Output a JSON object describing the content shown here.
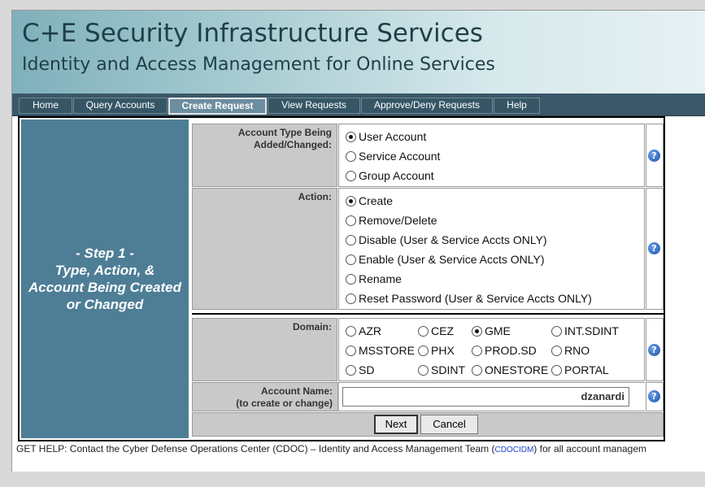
{
  "header": {
    "title": "C+E Security Infrastructure Services",
    "subtitle": "Identity and Access Management for Online Services"
  },
  "nav": {
    "tabs": [
      {
        "label": "Home"
      },
      {
        "label": "Query Accounts"
      },
      {
        "label": "Create Request",
        "active": true
      },
      {
        "label": "View Requests"
      },
      {
        "label": "Approve/Deny Requests"
      },
      {
        "label": "Help"
      }
    ]
  },
  "step": {
    "line1": "- Step 1 -",
    "line2": "Type, Action, &",
    "line3": "Account Being Created",
    "line4": "or Changed"
  },
  "account_type": {
    "label_line1": "Account Type Being",
    "label_line2": "Added/Changed:",
    "options": [
      "User Account",
      "Service Account",
      "Group Account"
    ],
    "selected": "User Account"
  },
  "action": {
    "label": "Action:",
    "options": [
      "Create",
      "Remove/Delete",
      "Disable (User & Service Accts ONLY)",
      "Enable (User & Service Accts ONLY)",
      "Rename",
      "Reset Password (User & Service Accts ONLY)"
    ],
    "selected": "Create"
  },
  "domain": {
    "label": "Domain:",
    "options": [
      "AZR",
      "CEZ",
      "GME",
      "INT.SDINT",
      "MSSTORE",
      "PHX",
      "PROD.SD",
      "RNO",
      "SD",
      "SDINT",
      "ONESTORE",
      "PORTAL"
    ],
    "selected": "GME"
  },
  "account_name": {
    "label_line1": "Account Name:",
    "label_line2": "(to create or change)",
    "value": "dzanardi"
  },
  "buttons": {
    "next": "Next",
    "cancel": "Cancel"
  },
  "help_icon": "question-icon",
  "footer": {
    "text_before": "GET HELP: Contact the Cyber Defense Operations Center (CDOC) – Identity and Access Management Team (",
    "link": "CDOCIDM",
    "text_after": ") for all account managem"
  },
  "colors": {
    "nav_bg": "#3b5868",
    "step_bg": "#4d7e96",
    "label_bg": "#c9c9c9",
    "link": "#1a44c4"
  }
}
